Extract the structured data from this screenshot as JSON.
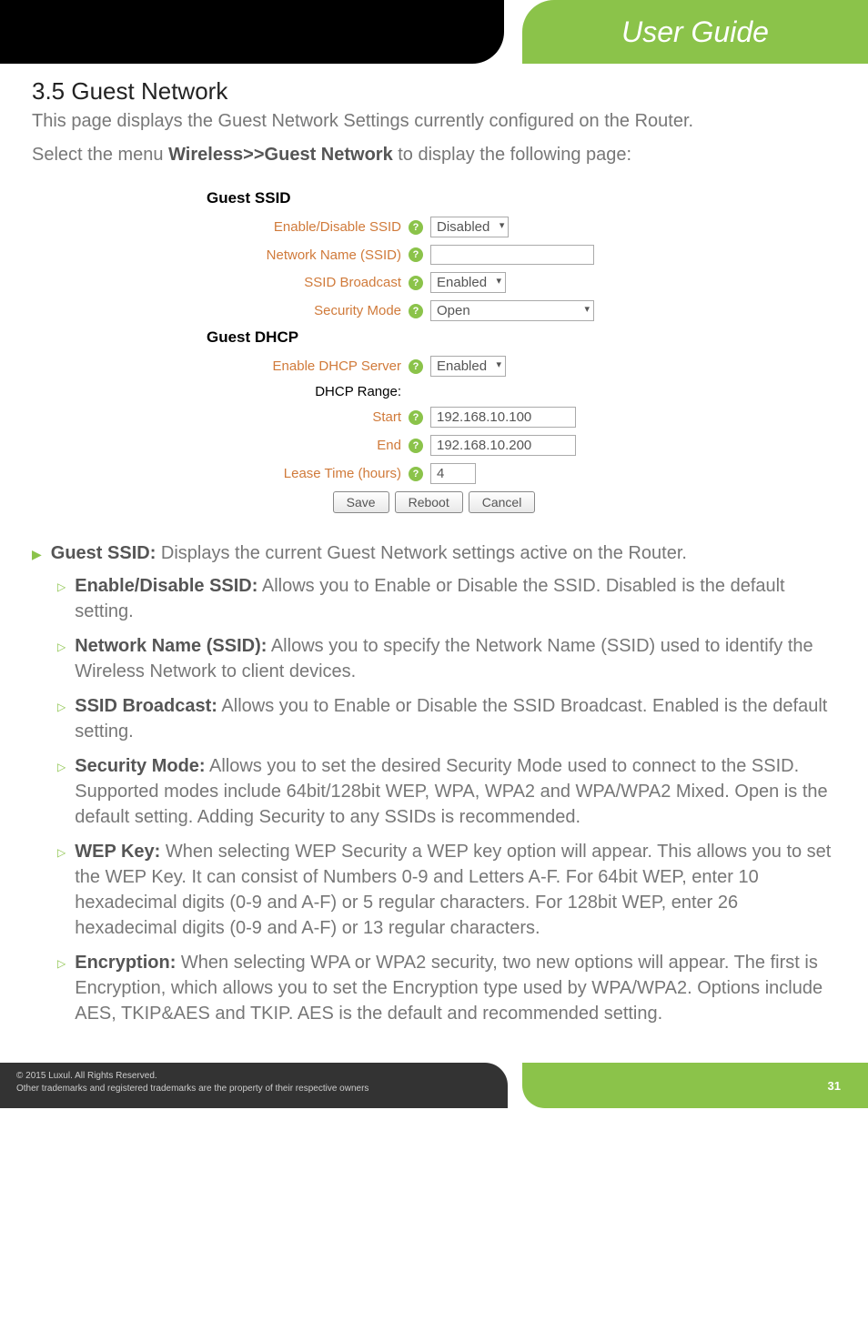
{
  "banner": {
    "title": "User Guide"
  },
  "section": {
    "heading": "3.5 Guest Network",
    "intro": "This page displays the Guest Network Settings currently configured on the Router.",
    "nav_prefix": "Select the menu ",
    "nav_path": "Wireless>>Guest Network",
    "nav_suffix": " to display the following page:"
  },
  "form": {
    "guest_ssid_header": "Guest SSID",
    "enable_disable_ssid_label": "Enable/Disable SSID",
    "enable_disable_ssid_value": "Disabled",
    "network_name_label": "Network Name (SSID)",
    "network_name_value": "",
    "ssid_broadcast_label": "SSID Broadcast",
    "ssid_broadcast_value": "Enabled",
    "security_mode_label": "Security Mode",
    "security_mode_value": "Open",
    "guest_dhcp_header": "Guest DHCP",
    "enable_dhcp_label": "Enable DHCP Server",
    "enable_dhcp_value": "Enabled",
    "dhcp_range_label": "DHCP Range:",
    "start_label": "Start",
    "start_value": "192.168.10.100",
    "end_label": "End",
    "end_value": "192.168.10.200",
    "lease_time_label": "Lease Time (hours)",
    "lease_time_value": "4",
    "save_btn": "Save",
    "reboot_btn": "Reboot",
    "cancel_btn": "Cancel"
  },
  "bullets": {
    "guest_ssid_title": "Guest SSID:",
    "guest_ssid_text": " Displays the current Guest Network settings active on the Router.",
    "enable_disable_title": "Enable/Disable SSID:",
    "enable_disable_text": " Allows you to Enable or Disable the SSID. Disabled is the default setting.",
    "network_name_title": "Network Name (SSID):",
    "network_name_text": " Allows you to specify the Network Name (SSID) used to identify the Wireless Network to client devices.",
    "ssid_broadcast_title": "SSID Broadcast:",
    "ssid_broadcast_text": " Allows you to Enable or Disable the SSID Broadcast. Enabled is the default setting.",
    "security_mode_title": "Security Mode:",
    "security_mode_text": " Allows you to set the desired Security Mode used to connect to the SSID. Supported modes include 64bit/128bit WEP, WPA, WPA2 and WPA/WPA2 Mixed. Open is the default setting. Adding Security to any SSIDs is recommended.",
    "wep_key_title": "WEP Key:",
    "wep_key_text": " When selecting WEP Security a WEP key option will appear. This allows you to set the WEP Key. It can consist of Numbers 0-9 and Letters A-F. For 64bit WEP, enter 10 hexadecimal digits (0-9 and A-F) or 5 regular characters. For 128bit WEP, enter 26 hexadecimal digits (0-9 and A-F) or 13 regular characters.",
    "encryption_title": "Encryption:",
    "encryption_text": " When selecting WPA or WPA2 security, two new options will appear. The first is Encryption, which allows you to set the Encryption type used by WPA/WPA2. Options include AES, TKIP&AES and TKIP. AES is the default and recommended setting."
  },
  "footer": {
    "copyright": "© 2015  Luxul. All Rights Reserved.",
    "trademark": "Other trademarks and registered trademarks are the property of their respective owners",
    "page": "31"
  }
}
